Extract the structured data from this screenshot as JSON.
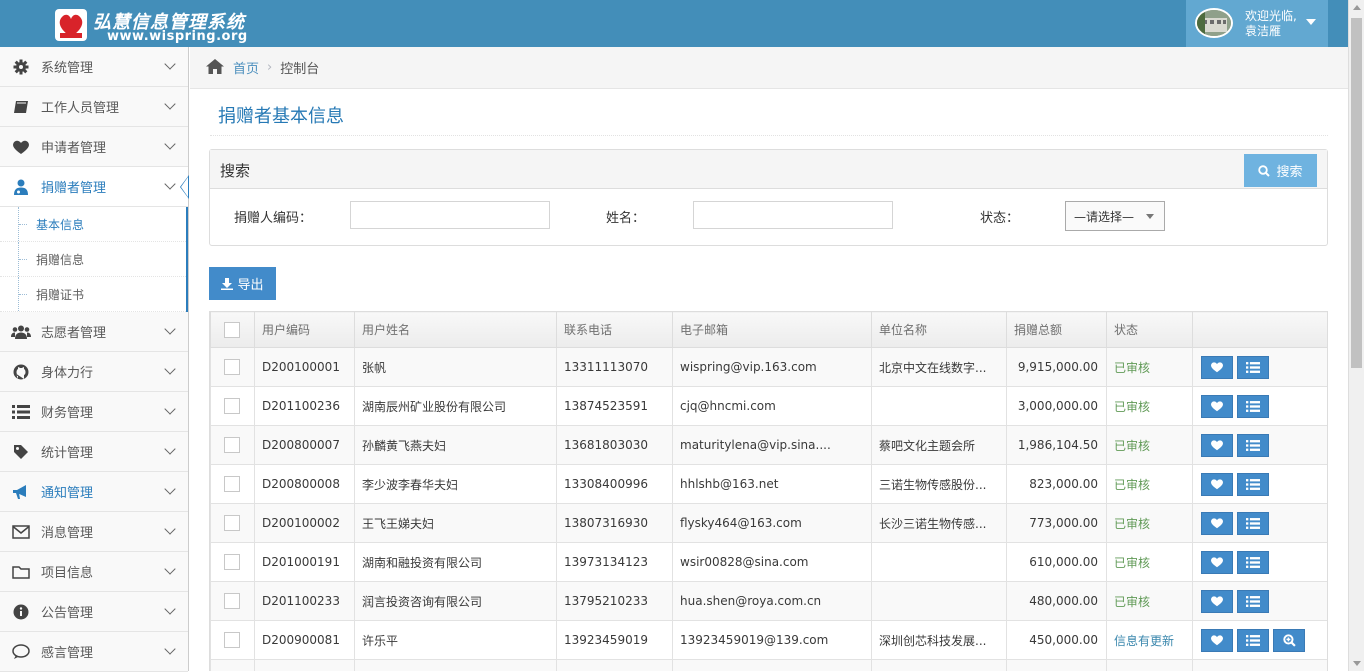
{
  "header": {
    "app_title": "弘慧信息管理系统",
    "app_url": "www.wispring.org",
    "welcome_line1": "欢迎光临,",
    "welcome_line2": "袁洁雁"
  },
  "sidebar": {
    "items": [
      {
        "label": "系统管理",
        "icon": "gear-icon"
      },
      {
        "label": "工作人员管理",
        "icon": "book-icon"
      },
      {
        "label": "申请者管理",
        "icon": "heart-icon"
      },
      {
        "label": "捐赠者管理",
        "icon": "user-md-icon",
        "active": true
      },
      {
        "label": "志愿者管理",
        "icon": "users-icon"
      },
      {
        "label": "身体力行",
        "icon": "github-icon"
      },
      {
        "label": "财务管理",
        "icon": "list-icon"
      },
      {
        "label": "统计管理",
        "icon": "tag-icon"
      },
      {
        "label": "通知管理",
        "icon": "bullhorn-icon",
        "highlight": true
      },
      {
        "label": "消息管理",
        "icon": "envelope-icon"
      },
      {
        "label": "项目信息",
        "icon": "folder-icon"
      },
      {
        "label": "公告管理",
        "icon": "info-icon"
      },
      {
        "label": "感言管理",
        "icon": "comment-icon"
      }
    ],
    "sub_items": [
      {
        "label": "基本信息",
        "active": true
      },
      {
        "label": "捐赠信息"
      },
      {
        "label": "捐赠证书"
      }
    ]
  },
  "breadcrumb": {
    "home": "首页",
    "current": "控制台"
  },
  "page": {
    "title": "捐赠者基本信息"
  },
  "search": {
    "title": "搜索",
    "button": "搜索",
    "code_label": "捐赠人编码：",
    "name_label": "姓名：",
    "status_label": "状态：",
    "status_value": "—请选择—"
  },
  "export_label": "导出",
  "table": {
    "headers": [
      "用户编码",
      "用户姓名",
      "联系电话",
      "电子邮箱",
      "单位名称",
      "捐赠总额",
      "状态"
    ],
    "rows": [
      {
        "code": "D200100001",
        "name": "张帆",
        "phone": "13311113070",
        "email": "wispring@vip.163.com",
        "org": "北京中文在线数字...",
        "amount": "9,915,000.00",
        "status": "已审核"
      },
      {
        "code": "D201100236",
        "name": "湖南辰州矿业股份有限公司",
        "phone": "13874523591",
        "email": "cjq@hncmi.com",
        "org": "",
        "amount": "3,000,000.00",
        "status": "已审核"
      },
      {
        "code": "D200800007",
        "name": "孙麟黄飞燕夫妇",
        "phone": "13681803030",
        "email": "maturitylena@vip.sina....",
        "org": "蔡吧文化主题会所",
        "amount": "1,986,104.50",
        "status": "已审核"
      },
      {
        "code": "D200800008",
        "name": "李少波李春华夫妇",
        "phone": "13308400996",
        "email": "hhlshb@163.net",
        "org": "三诺生物传感股份...",
        "amount": "823,000.00",
        "status": "已审核"
      },
      {
        "code": "D200100002",
        "name": "王飞王娣夫妇",
        "phone": "13807316930",
        "email": "flysky464@163.com",
        "org": "长沙三诺生物传感...",
        "amount": "773,000.00",
        "status": "已审核"
      },
      {
        "code": "D201000191",
        "name": "湖南和融投资有限公司",
        "phone": "13973134123",
        "email": "wsir00828@sina.com",
        "org": "",
        "amount": "610,000.00",
        "status": "已审核"
      },
      {
        "code": "D201100233",
        "name": "润言投资咨询有限公司",
        "phone": "13795210233",
        "email": "hua.shen@roya.com.cn",
        "org": "",
        "amount": "480,000.00",
        "status": "已审核"
      },
      {
        "code": "D200900081",
        "name": "许乐平",
        "phone": "13923459019",
        "email": "13923459019@139.com",
        "org": "深圳创芯科技发展...",
        "amount": "450,000.00",
        "status": "信息有更新"
      }
    ]
  },
  "colors": {
    "header": "#438eb9",
    "accent": "#2b7dbc",
    "approved": "#629b58",
    "button": "#428bca"
  }
}
